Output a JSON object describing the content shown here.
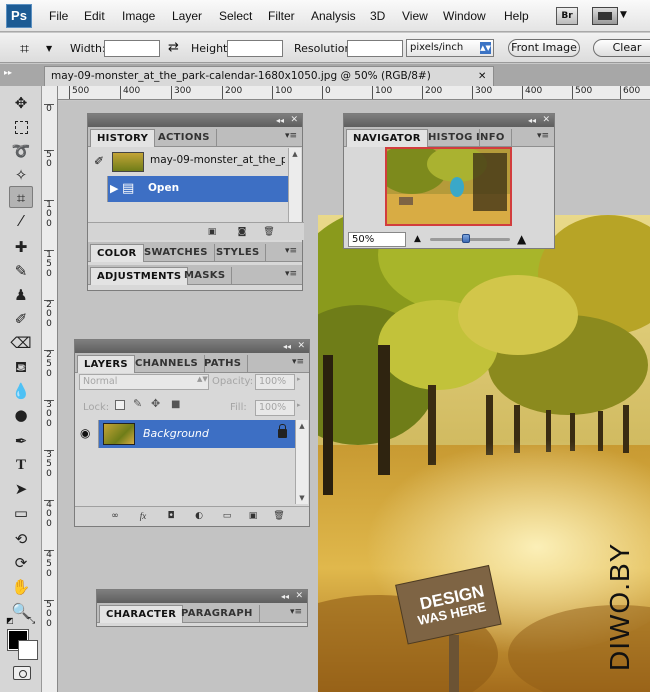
{
  "app": {
    "logo": "Ps",
    "menu": [
      "File",
      "Edit",
      "Image",
      "Layer",
      "Select",
      "Filter",
      "Analysis",
      "3D",
      "View",
      "Window",
      "Help"
    ],
    "bridge_label": "Br"
  },
  "options_bar": {
    "width_label": "Width:",
    "width_value": "",
    "height_label": "Height:",
    "height_value": "",
    "resolution_label": "Resolution:",
    "resolution_value": "",
    "units_selected": "pixels/inch",
    "front_image_label": "Front Image",
    "clear_label": "Clear"
  },
  "document": {
    "tab_title": "may-09-monster_at_the_park-calendar-1680x1050.jpg @ 50% (RGB/8#)",
    "watermark": "DIWO.BY",
    "sign_line1": "DESIGN",
    "sign_line2": "WAS HERE"
  },
  "rulers": {
    "horizontal": [
      "500",
      "400",
      "300",
      "200",
      "100",
      "0",
      "100",
      "200",
      "300",
      "400",
      "500",
      "600"
    ],
    "vertical": [
      "0",
      "5",
      "0",
      "1",
      "0",
      "0",
      "1",
      "5",
      "0",
      "2",
      "0",
      "0",
      "2",
      "5",
      "0",
      "3",
      "0",
      "0",
      "3",
      "5",
      "0",
      "4",
      "0",
      "0",
      "4",
      "5",
      "0",
      "5",
      "0",
      "0"
    ]
  },
  "history_panel": {
    "tabs": [
      "HISTORY",
      "ACTIONS"
    ],
    "snapshot_label": "may-09-monster_at_the_p...",
    "steps": [
      "Open"
    ]
  },
  "color_panel": {
    "tabs": [
      "COLOR",
      "SWATCHES",
      "STYLES"
    ]
  },
  "adjustments_panel": {
    "tabs": [
      "ADJUSTMENTS",
      "MASKS"
    ]
  },
  "navigator_panel": {
    "tabs": [
      "NAVIGATOR",
      "HISTOG",
      "INFO"
    ],
    "zoom": "50%"
  },
  "layers_panel": {
    "tabs": [
      "LAYERS",
      "CHANNELS",
      "PATHS"
    ],
    "blend_mode": "Normal",
    "opacity_label": "Opacity:",
    "opacity_value": "100%",
    "lock_label": "Lock:",
    "fill_label": "Fill:",
    "fill_value": "100%",
    "layers": [
      {
        "name": "Background"
      }
    ]
  },
  "character_panel": {
    "tabs": [
      "CHARACTER",
      "PARAGRAPH"
    ]
  }
}
